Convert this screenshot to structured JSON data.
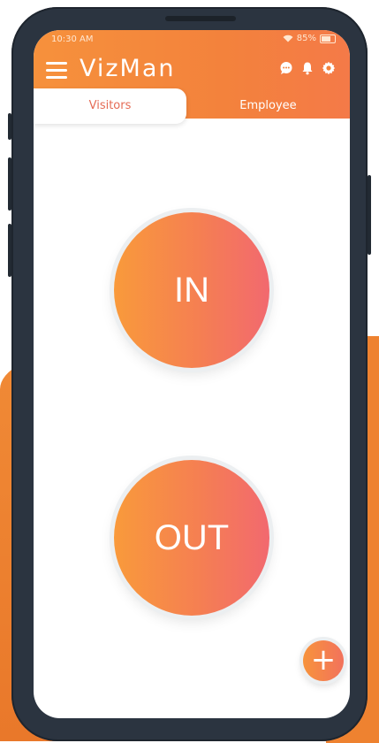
{
  "status": {
    "time": "10:30 AM",
    "battery": "85%"
  },
  "app": {
    "title": "VizMan"
  },
  "header": {
    "icons": [
      "menu-icon",
      "chat-icon",
      "bell-icon",
      "gear-icon"
    ]
  },
  "tabs": [
    {
      "label": "Visitors",
      "active": true
    },
    {
      "label": "Employee",
      "active": false
    }
  ],
  "actions": {
    "in_label": "IN",
    "out_label": "OUT",
    "fab_label": "+"
  },
  "colors": {
    "accent_start": "#f99a3b",
    "accent_end": "#f2696f",
    "header": "#f3823c",
    "active_tab_text": "#e56b55",
    "phone_frame": "#2b3440"
  }
}
